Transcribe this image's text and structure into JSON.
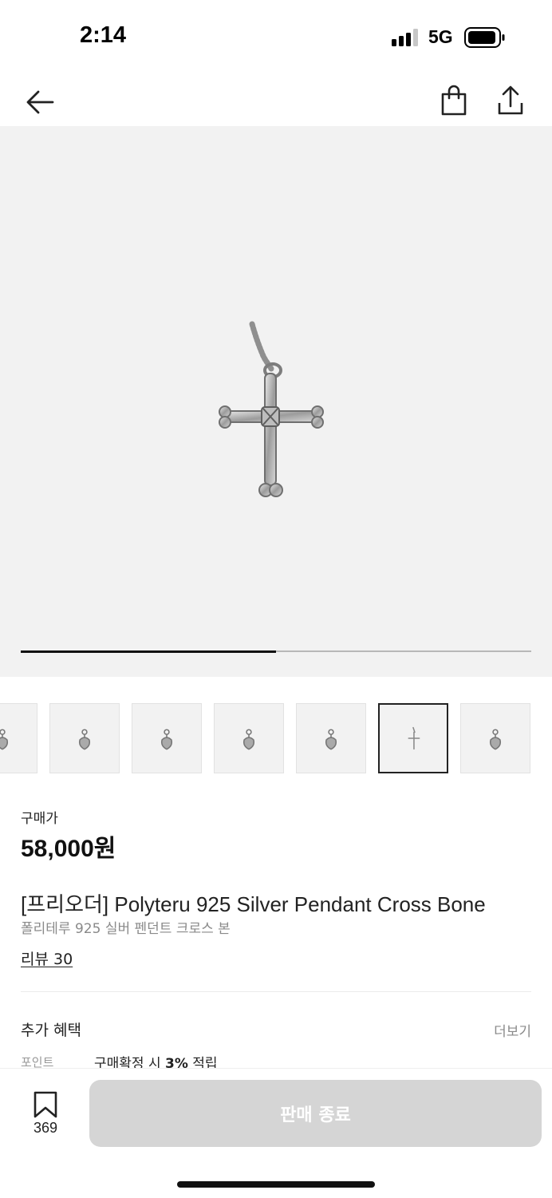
{
  "status_bar": {
    "time": "2:14",
    "network": "5G",
    "icons": [
      "signal-icon",
      "battery-icon"
    ]
  },
  "nav": {
    "icons": [
      "back-arrow-icon",
      "shopping-bag-icon",
      "share-icon"
    ]
  },
  "gallery": {
    "progress_fraction": 0.5,
    "thumbnails": [
      {
        "icon": "pendant-thumb-icon",
        "selected": false
      },
      {
        "icon": "pendant-thumb-icon",
        "selected": false
      },
      {
        "icon": "pendant-thumb-icon",
        "selected": false
      },
      {
        "icon": "pendant-thumb-icon",
        "selected": false
      },
      {
        "icon": "pendant-thumb-icon",
        "selected": false
      },
      {
        "icon": "cross-thumb-icon",
        "selected": true
      },
      {
        "icon": "pendant-thumb-icon",
        "selected": false
      }
    ]
  },
  "product": {
    "price_label": "구매가",
    "price": "58,000원",
    "title": "[프리오더] Polyteru 925 Silver Pendant Cross Bone",
    "subtitle": "폴리테루 925 실버 펜던트 크로스 본",
    "review_link": "리뷰 30"
  },
  "benefits": {
    "title": "추가 혜택",
    "more": "더보기",
    "point_label": "포인트",
    "point_text_prefix": "구매확정 시 ",
    "point_rate": "3%",
    "point_text_suffix": " 적립"
  },
  "bottom": {
    "bookmark_count": "369",
    "action_label": "판매 종료"
  },
  "colors": {
    "image_bg": "#f2f2f2",
    "disabled_button": "#d5d5d5",
    "muted_text": "#8a8a8a"
  }
}
